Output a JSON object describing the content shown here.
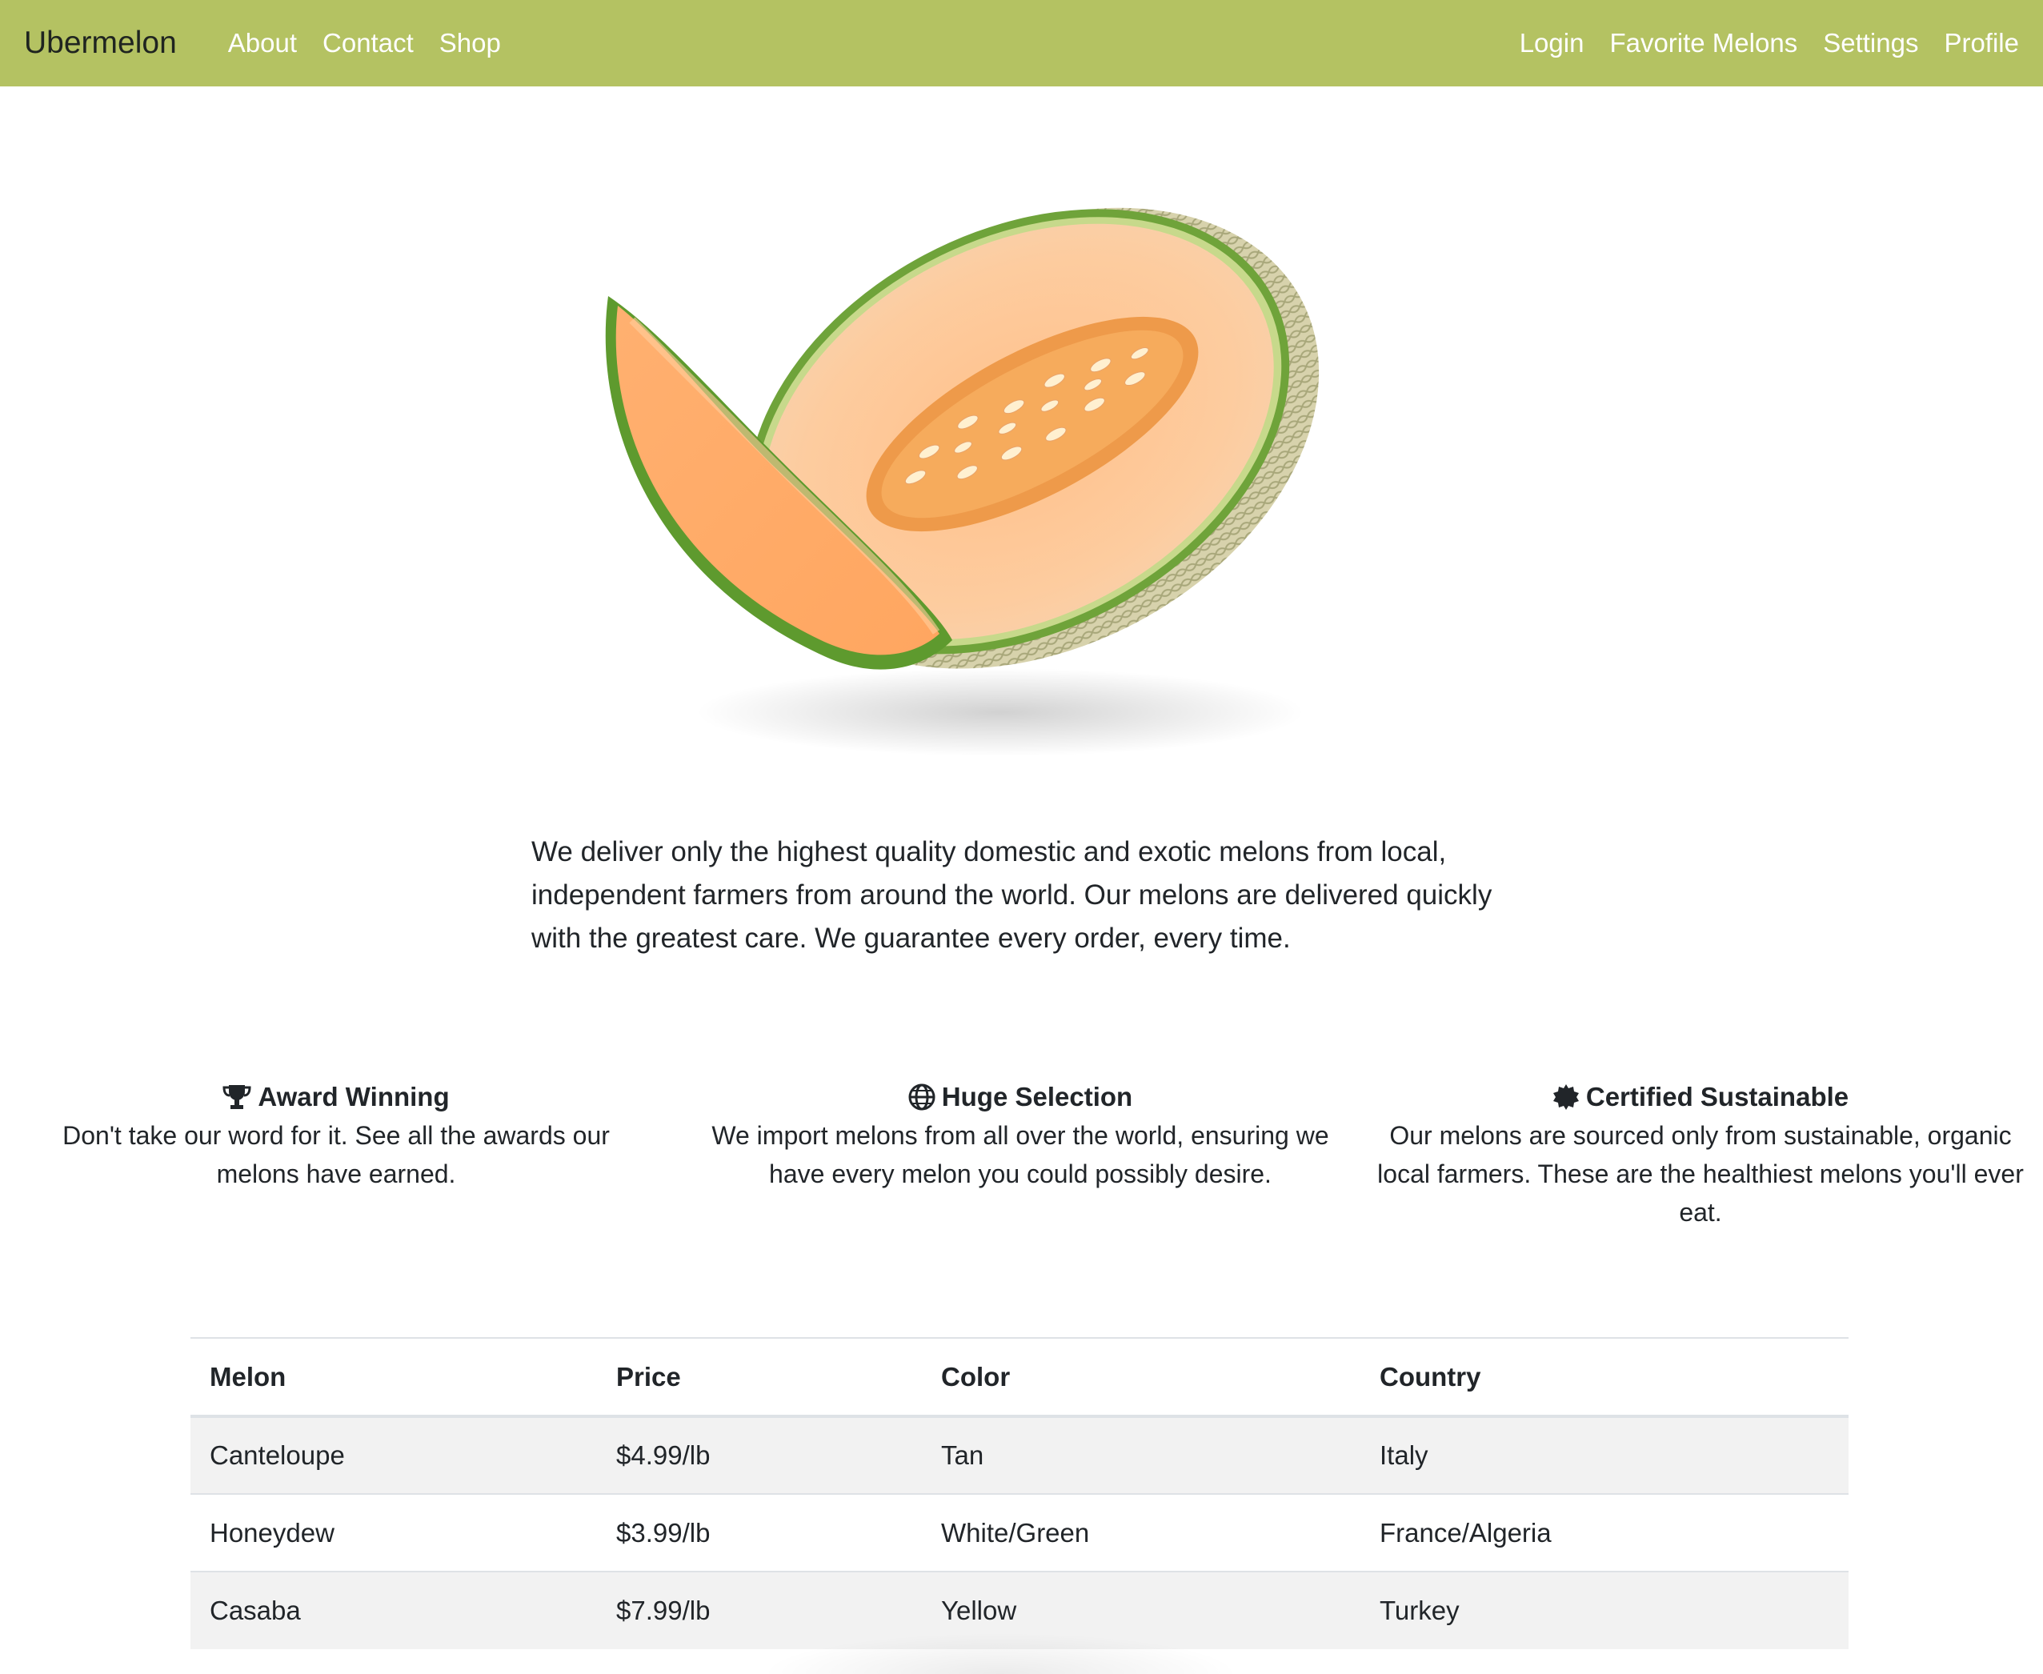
{
  "navbar": {
    "brand": "Ubermelon",
    "left_links": [
      "About",
      "Contact",
      "Shop"
    ],
    "right_links": [
      "Login",
      "Favorite Melons",
      "Settings",
      "Profile"
    ],
    "background_color": "#b4c262"
  },
  "hero": {
    "image_subject": "cantaloupe-melon"
  },
  "intro": {
    "text": "We deliver only the highest quality domestic and exotic melons from local, independent farmers from around the world. Our melons are delivered quickly with the greatest care. We guarantee every order, every time."
  },
  "features": [
    {
      "icon": "trophy-icon",
      "title": "Award Winning",
      "text": "Don't take our word for it. See all the awards our melons have earned."
    },
    {
      "icon": "globe-icon",
      "title": "Huge Selection",
      "text": "We import melons from all over the world, ensuring we have every melon you could possibly desire."
    },
    {
      "icon": "certificate-icon",
      "title": "Certified Sustainable",
      "text": "Our melons are sourced only from sustainable, organic local farmers. These are the healthiest melons you'll ever eat."
    }
  ],
  "table": {
    "headers": [
      "Melon",
      "Price",
      "Color",
      "Country"
    ],
    "rows": [
      [
        "Canteloupe",
        "$4.99/lb",
        "Tan",
        "Italy"
      ],
      [
        "Honeydew",
        "$3.99/lb",
        "White/Green",
        "France/Algeria"
      ],
      [
        "Casaba",
        "$7.99/lb",
        "Yellow",
        "Turkey"
      ]
    ]
  }
}
